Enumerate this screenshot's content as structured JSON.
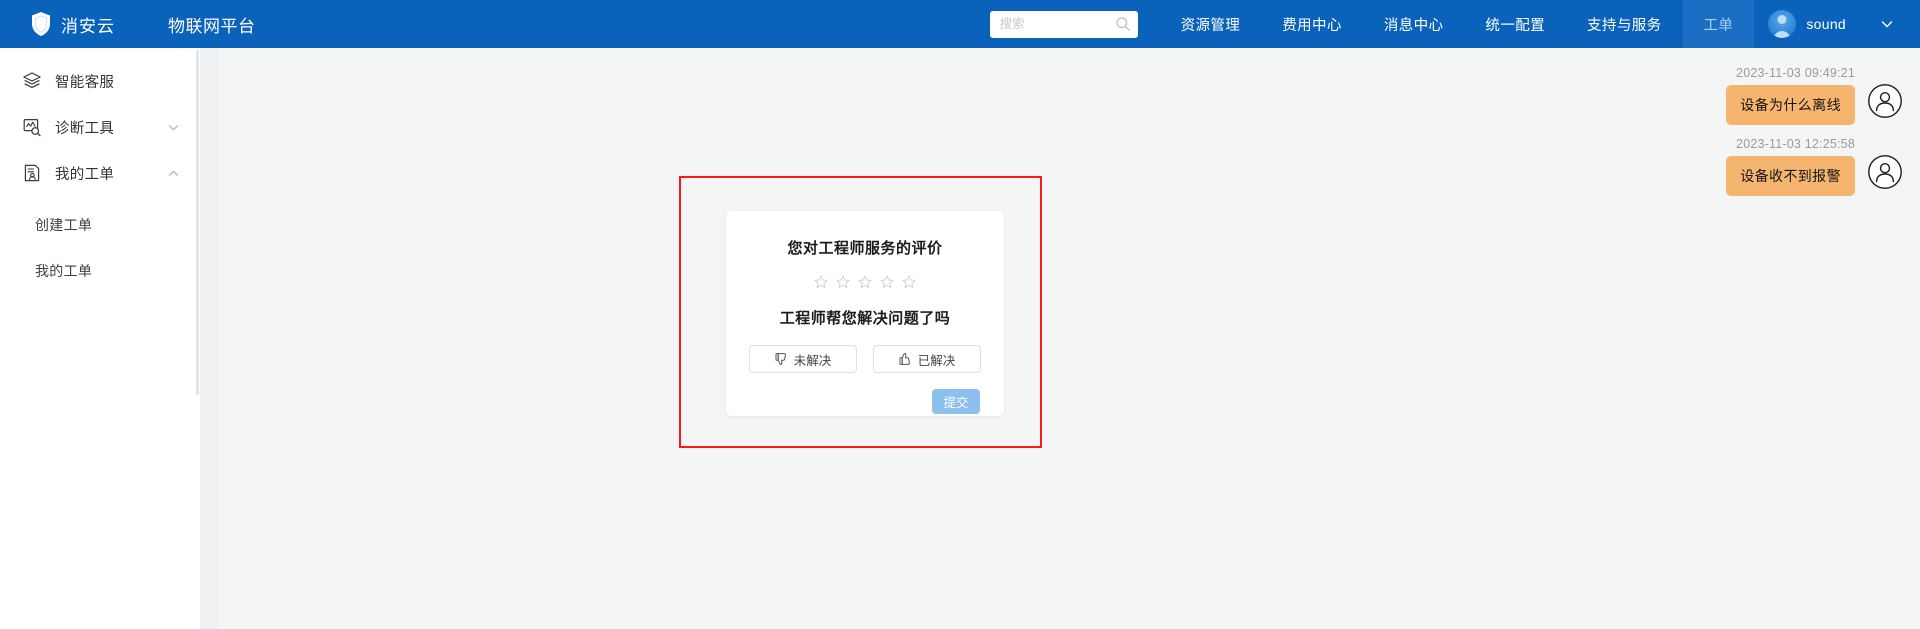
{
  "header": {
    "brand_name": "消安云",
    "brand_logo_icon": "shield-icon",
    "platform_title": "物联网平台",
    "search": {
      "value": "",
      "placeholder": "搜索",
      "icon": "search-icon"
    },
    "nav_items": [
      {
        "label": "资源管理",
        "active": false
      },
      {
        "label": "费用中心",
        "active": false
      },
      {
        "label": "消息中心",
        "active": false
      },
      {
        "label": "统一配置",
        "active": false
      },
      {
        "label": "支持与服务",
        "active": false
      },
      {
        "label": "工单",
        "active": true
      }
    ],
    "user": {
      "name": "sound",
      "avatar_icon": "user-avatar-icon",
      "dropdown_icon": "chevron-down-icon"
    },
    "colors": {
      "bar_bg": "#0a62bb",
      "active_tab_bg": "#1a6fc4",
      "active_tab_text": "#a8cdf0"
    }
  },
  "sidebar": {
    "items": [
      {
        "label": "智能客服",
        "icon": "layers-icon",
        "expandable": false,
        "chevron": ""
      },
      {
        "label": "诊断工具",
        "icon": "chart-search-icon",
        "expandable": true,
        "chevron": "chevron-down-icon"
      },
      {
        "label": "我的工单",
        "icon": "ticket-document-icon",
        "expandable": true,
        "chevron": "chevron-up-icon"
      }
    ],
    "sub_items": [
      {
        "label": "创建工单"
      },
      {
        "label": "我的工单"
      }
    ]
  },
  "chat": {
    "messages": [
      {
        "time": "2023-11-03 09:49:21",
        "text": "设备为什么离线",
        "avatar_icon": "user-circle-icon"
      },
      {
        "time": "2023-11-03 12:25:58",
        "text": "设备收不到报警",
        "avatar_icon": "user-circle-icon"
      }
    ],
    "bubble_color": "#f5b56e"
  },
  "annotation": {
    "shape": "rectangle",
    "color": "#fb1a1a"
  },
  "survey_card": {
    "title": "您对工程师服务的评价",
    "rating": {
      "max": 5,
      "value": 0,
      "star_icon": "star-outline-icon"
    },
    "question": "工程师帮您解决问题了吗",
    "choices": [
      {
        "label": "未解决",
        "icon": "thumbs-down-icon",
        "selected": false
      },
      {
        "label": "已解决",
        "icon": "thumbs-up-icon",
        "selected": false
      }
    ],
    "submit_label": "提交",
    "submit_color": "#8cc0ef"
  }
}
